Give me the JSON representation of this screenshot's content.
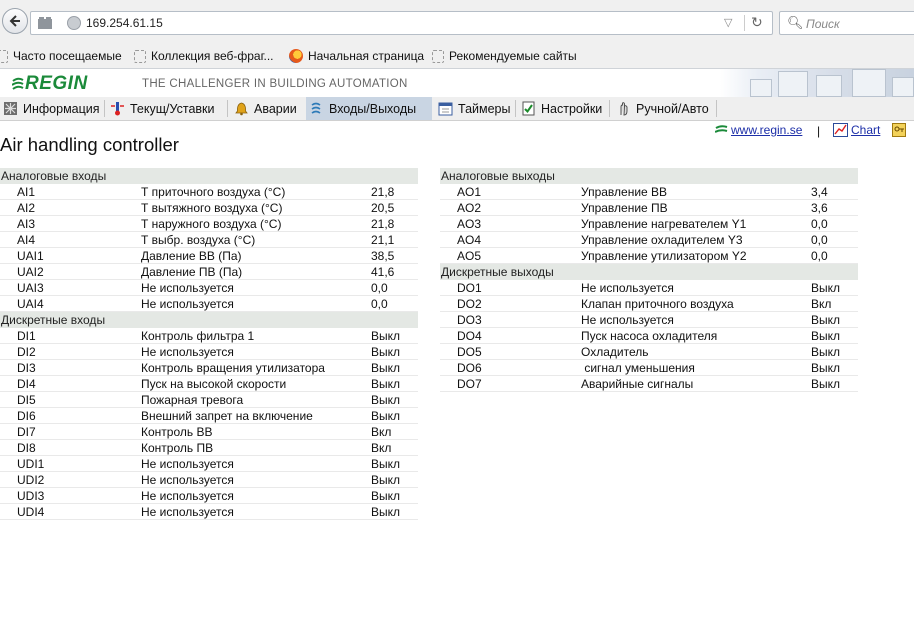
{
  "browser": {
    "url": "169.254.61.15",
    "search_placeholder": "Поиск",
    "bookmarks": [
      {
        "label": "Часто посещаемые",
        "icon": "bookmark-icon"
      },
      {
        "label": "Коллекция веб-фраг...",
        "icon": "webslice-icon"
      },
      {
        "label": "Начальная страница",
        "icon": "firefox-icon"
      },
      {
        "label": "Рекомендуемые сайты",
        "icon": "webslice-icon"
      }
    ]
  },
  "header": {
    "logo": "REGIN",
    "tagline": "THE CHALLENGER IN BUILDING AUTOMATION",
    "brand_color": "#1b8a3a"
  },
  "menu": [
    {
      "label": "Информация",
      "icon": "info-icon",
      "active": false
    },
    {
      "label": "Текущ/Уставки",
      "icon": "thermometer-icon",
      "active": false
    },
    {
      "label": "Аварии",
      "icon": "bell-icon",
      "active": false
    },
    {
      "label": "Входы/Выходы",
      "icon": "io-icon",
      "active": true
    },
    {
      "label": "Таймеры",
      "icon": "calendar-icon",
      "active": false
    },
    {
      "label": "Настройки",
      "icon": "checklist-icon",
      "active": false
    },
    {
      "label": "Ручной/Авто",
      "icon": "hand-icon",
      "active": false
    }
  ],
  "links": {
    "website": "www.regin.se",
    "separator": "|",
    "chart": "Chart"
  },
  "page": {
    "title": "Air handling controller"
  },
  "left": {
    "analog_inputs": {
      "title": "Аналоговые входы",
      "rows": [
        [
          "AI1",
          "Т приточного воздуха (°С)",
          "21,8"
        ],
        [
          "AI2",
          "Т вытяжного воздуха (°С)",
          "20,5"
        ],
        [
          "AI3",
          "Т наружного воздуха (°С)",
          "21,8"
        ],
        [
          "AI4",
          "Т выбр. воздуха (°С)",
          "21,1"
        ],
        [
          "UAI1",
          "Давление ВВ (Па)",
          "38,5"
        ],
        [
          "UAI2",
          "Давление ПВ (Па)",
          "41,6"
        ],
        [
          "UAI3",
          "Не используется",
          "0,0"
        ],
        [
          "UAI4",
          "Не используется",
          "0,0"
        ]
      ]
    },
    "digital_inputs": {
      "title": "Дискретные входы",
      "rows": [
        [
          "DI1",
          "Контроль фильтра 1",
          "Выкл"
        ],
        [
          "DI2",
          "Не используется",
          "Выкл"
        ],
        [
          "DI3",
          "Контроль вращения утилизатора",
          "Выкл"
        ],
        [
          "DI4",
          "Пуск на высокой скорости",
          "Выкл"
        ],
        [
          "DI5",
          "Пожарная тревога",
          "Выкл"
        ],
        [
          "DI6",
          "Внешний запрет на включение",
          "Выкл"
        ],
        [
          "DI7",
          "Контроль ВВ",
          "Вкл"
        ],
        [
          "DI8",
          "Контроль ПВ",
          "Вкл"
        ],
        [
          "UDI1",
          "Не используется",
          "Выкл"
        ],
        [
          "UDI2",
          "Не используется",
          "Выкл"
        ],
        [
          "UDI3",
          "Не используется",
          "Выкл"
        ],
        [
          "UDI4",
          "Не используется",
          "Выкл"
        ]
      ]
    }
  },
  "right": {
    "analog_outputs": {
      "title": "Аналоговые выходы",
      "rows": [
        [
          "AO1",
          "Управление ВВ",
          "3,4"
        ],
        [
          "AO2",
          "Управление ПВ",
          "3,6"
        ],
        [
          "AO3",
          "Управление нагревателем Y1",
          "0,0"
        ],
        [
          "AO4",
          "Управление охладителем Y3",
          "0,0"
        ],
        [
          "AO5",
          "Управление утилизатором Y2",
          "0,0"
        ]
      ]
    },
    "digital_outputs": {
      "title": "Дискретные выходы",
      "rows": [
        [
          "DO1",
          "Не используется",
          "Выкл"
        ],
        [
          "DO2",
          "Клапан приточного воздуха",
          "Вкл"
        ],
        [
          "DO3",
          "Не используется",
          "Выкл"
        ],
        [
          "DO4",
          "Пуск насоса охладителя",
          "Выкл"
        ],
        [
          "DO5",
          "Охладитель",
          "Выкл"
        ],
        [
          "DO6",
          " сигнал уменьшения",
          "Выкл"
        ],
        [
          "DO7",
          "Аварийные сигналы",
          "Выкл"
        ]
      ]
    }
  }
}
